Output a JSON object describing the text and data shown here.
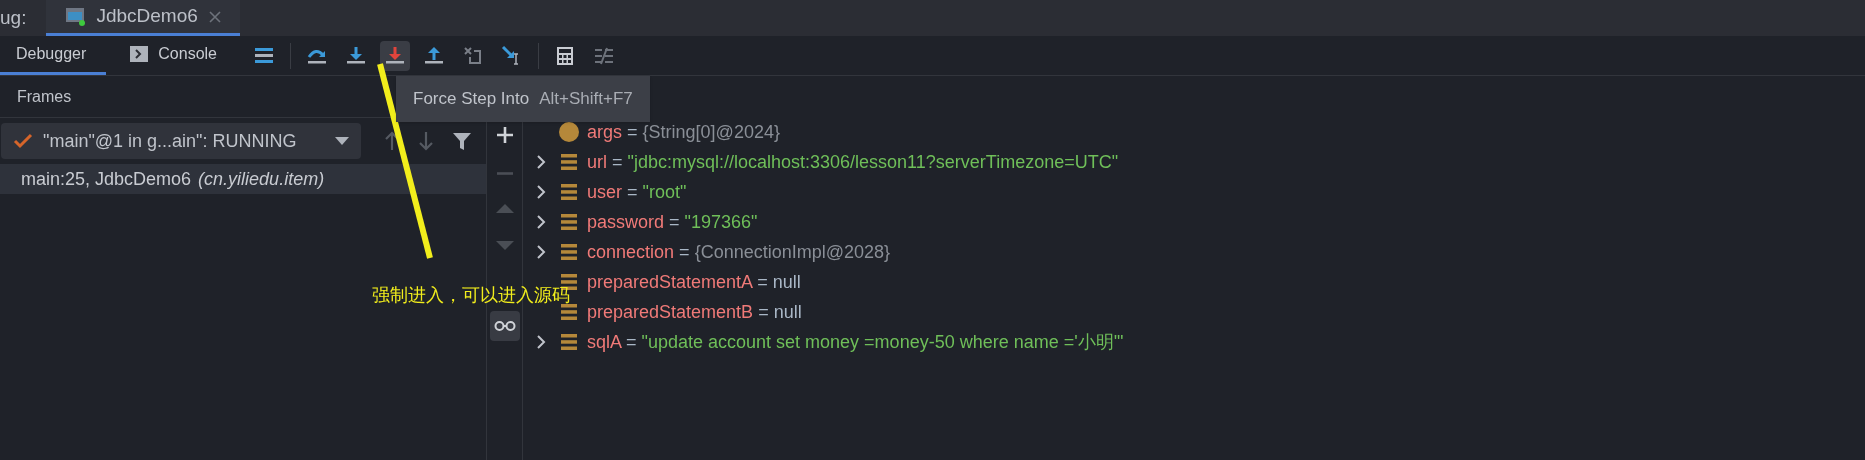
{
  "debug_label": "ug:",
  "session_tabs": [
    {
      "label": "JdbcDemo6",
      "selected": true
    }
  ],
  "view_tabs": [
    {
      "label": "Debugger",
      "selected": true
    },
    {
      "label": "Console",
      "selected": false
    }
  ],
  "tooltip": {
    "title": "Force Step Into",
    "shortcut": "Alt+Shift+F7"
  },
  "frames": {
    "title": "Frames",
    "thread": "\"main\"@1 in g...ain\": RUNNING",
    "items": [
      {
        "method": "main:25, JdbcDemo6",
        "package": "(cn.yiliedu.item)",
        "selected": true
      }
    ]
  },
  "variables": [
    {
      "kind": "param",
      "name": "args",
      "operator": "=",
      "value": "{String[0]@2024}",
      "color": "#8a8f97",
      "expandable": false
    },
    {
      "kind": "field",
      "name": "url",
      "operator": "=",
      "value": "\"jdbc:mysql://localhost:3306/lesson11?serverTimezone=UTC\"",
      "color": "#6fbf59",
      "expandable": true
    },
    {
      "kind": "field",
      "name": "user",
      "operator": "=",
      "value": "\"root\"",
      "color": "#6fbf59",
      "expandable": true
    },
    {
      "kind": "field",
      "name": "password",
      "operator": "=",
      "value": "\"197366\"",
      "color": "#6fbf59",
      "expandable": true
    },
    {
      "kind": "field",
      "name": "connection",
      "operator": "=",
      "value": "{ConnectionImpl@2028}",
      "color": "#8a8f97",
      "expandable": true
    },
    {
      "kind": "field",
      "name": "preparedStatementA",
      "operator": "=",
      "value": "null",
      "color": "#a9b7c6",
      "expandable": false
    },
    {
      "kind": "field",
      "name": "preparedStatementB",
      "operator": "=",
      "value": "null",
      "color": "#a9b7c6",
      "expandable": false
    },
    {
      "kind": "field",
      "name": "sqlA",
      "operator": "=",
      "value": "\"update account set money =money-50 where name ='小明'\"",
      "color": "#6fbf59",
      "expandable": true
    }
  ],
  "annotation": {
    "text": "强制进入，可以进入源码"
  }
}
